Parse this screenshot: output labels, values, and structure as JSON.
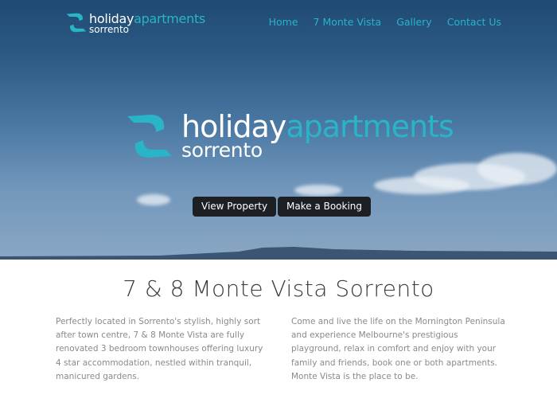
{
  "brand": {
    "word_holiday": "holiday",
    "word_apartments": "apartments",
    "word_sorrento": "sorrento",
    "accent_color": "#29b4c8",
    "logo_icon": "ribbon-s-logo"
  },
  "nav": {
    "items": [
      {
        "label": "Home"
      },
      {
        "label": "7 Monte Vista"
      },
      {
        "label": "Gallery"
      },
      {
        "label": "Contact Us"
      }
    ]
  },
  "hero": {
    "button_view": "View Property",
    "button_book": "Make a Booking"
  },
  "main": {
    "title": "7 & 8 Monte Vista Sorrento",
    "paragraph_left": "Perfectly located in Sorrento's stylish, highly sort after town centre, 7 & 8 Monte Vista are fully renovated 3 bedroom townhouses offering luxury 4 star accommodation, nestled within tranquil, manicured gardens.",
    "paragraph_right": "Come and live the life on the Mornington Peninsula and experience Melbourne's prestigious playground, relax in comfort and enjoy with your family and friends, book one or both apartments.  Monte Vista is the place to be."
  }
}
